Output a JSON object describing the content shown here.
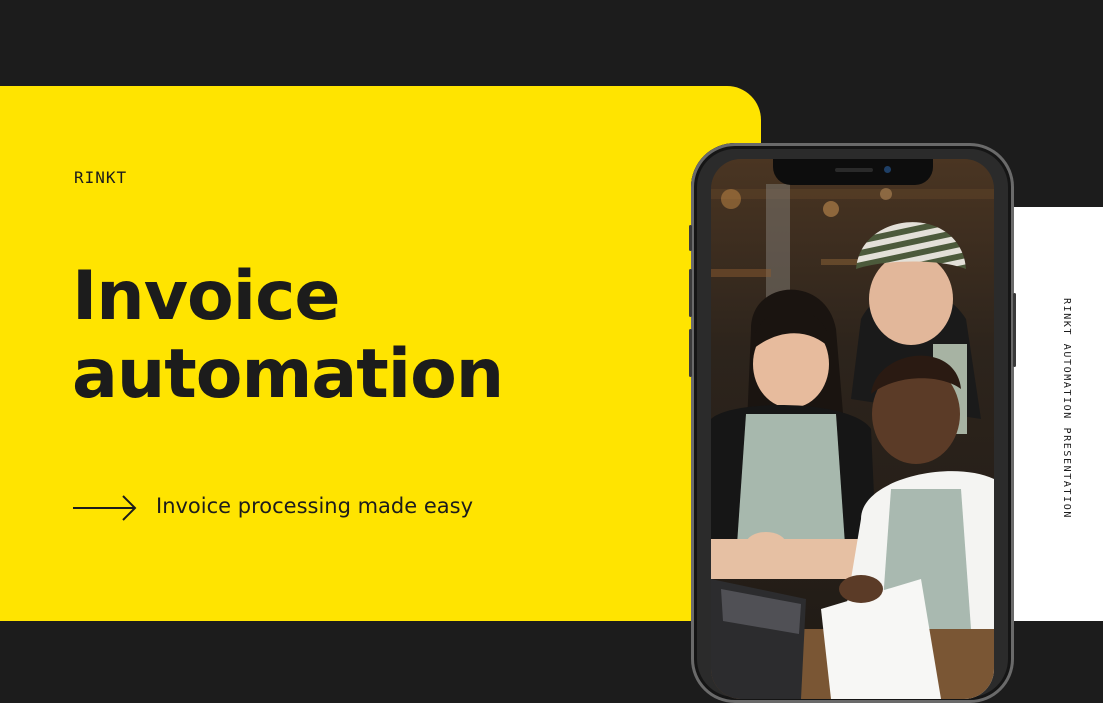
{
  "brand": "RINKT",
  "title_line1": "Invoice",
  "title_line2": "automation",
  "tagline": "Invoice processing made easy",
  "side_text": "RINKT AUTOMATION PRESENTATION",
  "colors": {
    "yellow": "#ffe400",
    "dark": "#1c1c1c",
    "white": "#ffffff"
  },
  "icons": {
    "arrow": "arrow-right-icon"
  },
  "photo": "three people looking at a laptop"
}
